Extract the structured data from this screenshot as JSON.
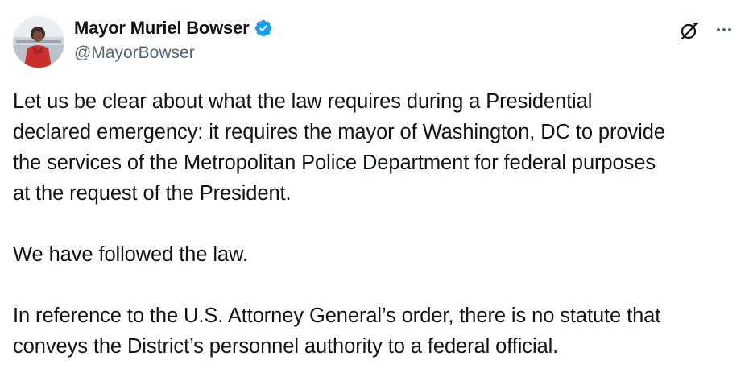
{
  "author": {
    "display_name": "Mayor Muriel Bowser",
    "handle": "@MayorBowser",
    "verified": true,
    "verified_color": "#1d9bf0"
  },
  "icons": {
    "grok": "grok-icon",
    "more": "more-options-icon",
    "verified": "verified-badge-icon"
  },
  "tweet": {
    "paragraph_1_lines": [
      "Let us be clear about what the law requires during a Presidential",
      "declared emergency: it requires the mayor of Washington, DC to provide",
      "the services of the Metropolitan Police Department for federal purposes",
      "at the request of the President."
    ],
    "paragraph_2": "We have followed the law.",
    "paragraph_3_lines": [
      "In reference to the U.S. Attorney General’s order, there is no statute that",
      "conveys the District’s personnel authority to a federal official."
    ]
  }
}
